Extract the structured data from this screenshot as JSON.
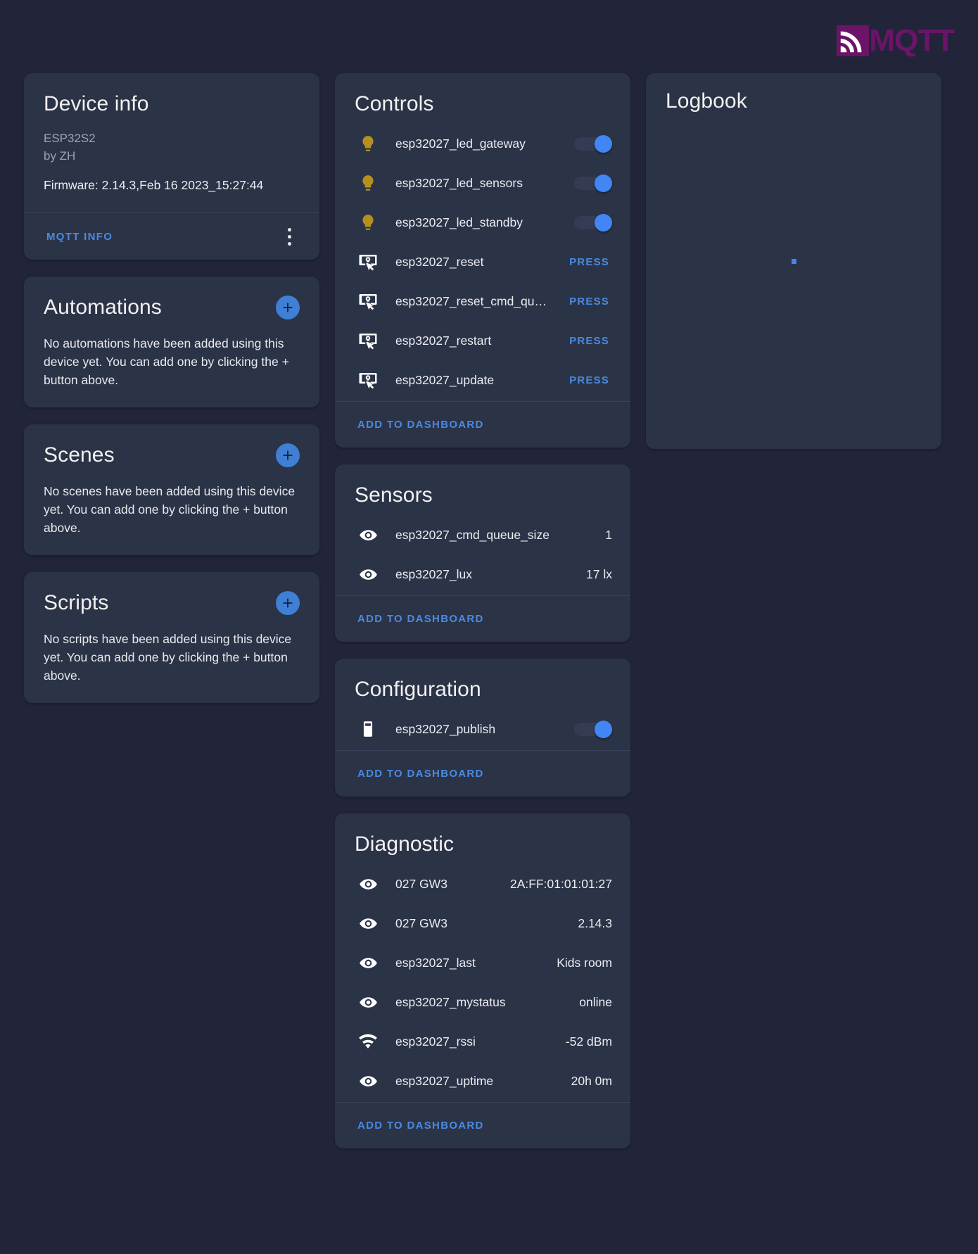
{
  "brand": {
    "name": "MQTT",
    "mark": "mqtt-signal-icon",
    "color": "#6b1468"
  },
  "device_info": {
    "title": "Device info",
    "model": "ESP32S2",
    "manufacturer": "by ZH",
    "firmware": "Firmware: 2.14.3,Feb 16 2023_15:27:44",
    "mqtt_info_label": "MQTT INFO",
    "menu_icon": "dots-vertical-icon"
  },
  "automations": {
    "title": "Automations",
    "add_icon": "plus-icon",
    "empty": "No automations have been added using this device yet. You can add one by clicking the + button above."
  },
  "scenes": {
    "title": "Scenes",
    "add_icon": "plus-icon",
    "empty": "No scenes have been added using this device yet. You can add one by clicking the + button above."
  },
  "scripts": {
    "title": "Scripts",
    "add_icon": "plus-icon",
    "empty": "No scripts have been added using this device yet. You can add one by clicking the + button above."
  },
  "controls": {
    "title": "Controls",
    "add_to_dashboard_label": "ADD TO DASHBOARD",
    "rows": [
      {
        "icon": "lightbulb-icon",
        "name": "esp32027_led_gateway",
        "control": "toggle",
        "state": "on"
      },
      {
        "icon": "lightbulb-icon",
        "name": "esp32027_led_sensors",
        "control": "toggle",
        "state": "on"
      },
      {
        "icon": "lightbulb-icon",
        "name": "esp32027_led_standby",
        "control": "toggle",
        "state": "on"
      },
      {
        "icon": "gesture-tap-button-icon",
        "name": "esp32027_reset",
        "control": "press",
        "action": "PRESS"
      },
      {
        "icon": "gesture-tap-button-icon",
        "name": "esp32027_reset_cmd_qu…",
        "control": "press",
        "action": "PRESS"
      },
      {
        "icon": "gesture-tap-button-icon",
        "name": "esp32027_restart",
        "control": "press",
        "action": "PRESS"
      },
      {
        "icon": "gesture-tap-button-icon",
        "name": "esp32027_update",
        "control": "press",
        "action": "PRESS"
      }
    ]
  },
  "sensors": {
    "title": "Sensors",
    "add_to_dashboard_label": "ADD TO DASHBOARD",
    "rows": [
      {
        "icon": "eye-icon",
        "name": "esp32027_cmd_queue_size",
        "value": "1"
      },
      {
        "icon": "eye-icon",
        "name": "esp32027_lux",
        "value": "17 lx"
      }
    ]
  },
  "configuration": {
    "title": "Configuration",
    "add_to_dashboard_label": "ADD TO DASHBOARD",
    "rows": [
      {
        "icon": "toggle-switch-outline-icon",
        "name": "esp32027_publish",
        "control": "toggle",
        "state": "on"
      }
    ]
  },
  "diagnostic": {
    "title": "Diagnostic",
    "add_to_dashboard_label": "ADD TO DASHBOARD",
    "rows": [
      {
        "icon": "eye-icon",
        "name": "027 GW3",
        "value": "2A:FF:01:01:01:27"
      },
      {
        "icon": "eye-icon",
        "name": "027 GW3",
        "value": "2.14.3"
      },
      {
        "icon": "eye-icon",
        "name": "esp32027_last",
        "value": "Kids room"
      },
      {
        "icon": "eye-icon",
        "name": "esp32027_mystatus",
        "value": "online"
      },
      {
        "icon": "wifi-icon",
        "name": "esp32027_rssi",
        "value": "-52 dBm"
      },
      {
        "icon": "eye-icon",
        "name": "esp32027_uptime",
        "value": "20h 0m"
      }
    ]
  },
  "logbook": {
    "title": "Logbook",
    "loading_indicator": "loading-dot"
  }
}
